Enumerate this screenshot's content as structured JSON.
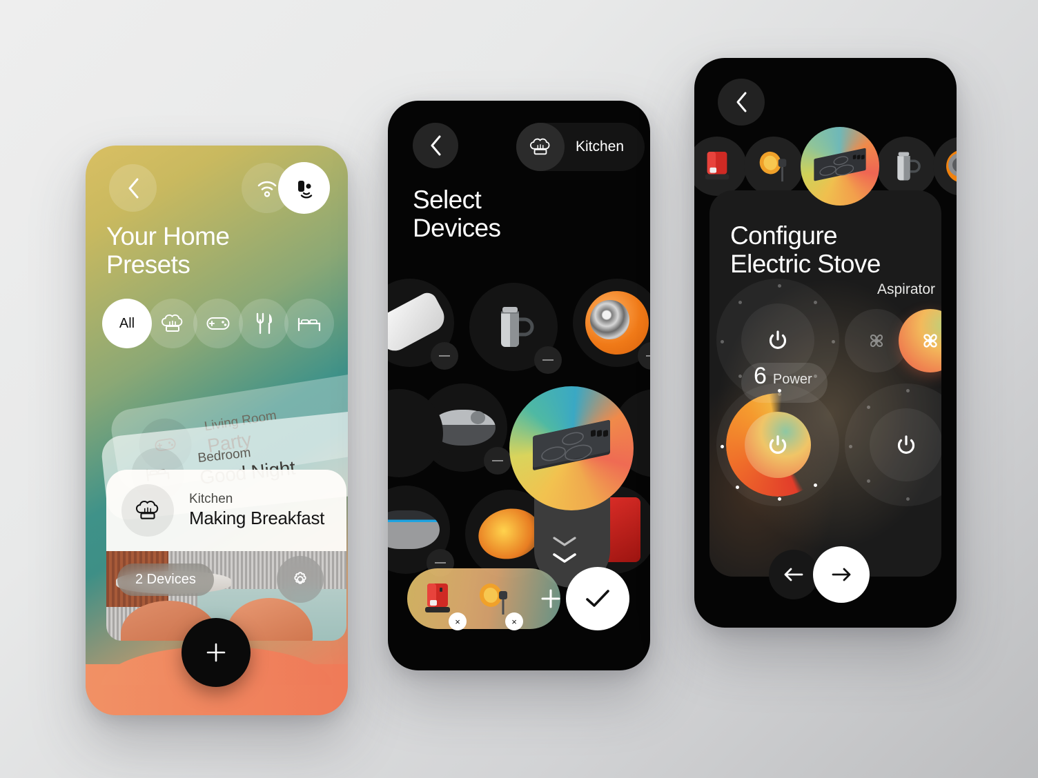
{
  "background": {
    "from": "#eeeeee",
    "to": "#bcbdbf"
  },
  "screen_presets": {
    "title_line1": "Your Home",
    "title_line2": "Presets",
    "back_icon": "chevron-left-icon",
    "wifi_icon": "wifi-icon",
    "cast_icon": "cast-device-icon",
    "categories": [
      {
        "label": "All",
        "icon": "all-label",
        "active": true
      },
      {
        "label": "Kitchen",
        "icon": "chef-hat-icon",
        "active": false
      },
      {
        "label": "Games",
        "icon": "gamepad-icon",
        "active": false
      },
      {
        "label": "Dining",
        "icon": "cutlery-icon",
        "active": false
      },
      {
        "label": "Bedroom",
        "icon": "bed-icon",
        "active": false
      }
    ],
    "cards": [
      {
        "room": "Living Room",
        "name": "Party",
        "icon": "gamepad-icon"
      },
      {
        "room": "Bedroom",
        "name": "Good Night",
        "icon": "bed-icon"
      },
      {
        "room": "Kitchen",
        "name": "Making Breakfast",
        "icon": "chef-hat-icon"
      }
    ],
    "devices_pill": "2 Devices",
    "settings_icon": "gear-icon",
    "add_button_icon": "plus-icon"
  },
  "screen_select": {
    "title_line1": "Select",
    "title_line2": "Devices",
    "back_icon": "chevron-left-icon",
    "room_chip": {
      "label": "Kitchen",
      "icon": "chef-hat-icon"
    },
    "devices": [
      {
        "name": "Air Conditioner",
        "icon": "air-conditioner-icon",
        "selected": false
      },
      {
        "name": "Electric Kettle",
        "icon": "kettle-icon",
        "selected": false
      },
      {
        "name": "Smart Speaker",
        "icon": "orange-speaker-icon",
        "selected": false
      },
      {
        "name": "Robot Vacuum",
        "icon": "robot-vacuum-icon",
        "selected": false
      },
      {
        "name": "Electric Stove",
        "icon": "electric-stove-icon",
        "selected": true
      },
      {
        "name": "Smart Assistant",
        "icon": "echo-dot-icon",
        "selected": false
      },
      {
        "name": "Studio Lamp",
        "icon": "studio-lamp-icon",
        "selected": false
      },
      {
        "name": "Coffee Machine",
        "icon": "coffee-machine-icon",
        "selected": false
      }
    ],
    "tray": [
      {
        "name": "Coffee Machine",
        "icon": "coffee-machine-icon",
        "remove_label": "×"
      },
      {
        "name": "Studio Lamp",
        "icon": "studio-lamp-icon",
        "remove_label": "×"
      }
    ],
    "add_icon": "plus-icon",
    "confirm_icon": "check-icon",
    "expand_icon": "chevron-down-icon"
  },
  "screen_configure": {
    "title_line1": "Configure",
    "title_line2": "Electric Stove",
    "back_icon": "chevron-left-icon",
    "carousel": [
      {
        "name": "Coffee Machine",
        "icon": "coffee-machine-icon",
        "active": false
      },
      {
        "name": "Studio Lamp",
        "icon": "studio-lamp-icon",
        "active": false
      },
      {
        "name": "Electric Stove",
        "icon": "electric-stove-icon",
        "active": true
      },
      {
        "name": "Electric Kettle",
        "icon": "kettle-icon",
        "active": false
      },
      {
        "name": "Smart Speaker",
        "icon": "orange-speaker-icon",
        "active": false
      }
    ],
    "aspirator": {
      "label": "Aspirator",
      "off_icon": "fan-icon",
      "on_icon": "fan-icon",
      "state": "on"
    },
    "power_badge": {
      "value": "6",
      "label": "Power"
    },
    "dials": [
      {
        "name": "burner-top-left",
        "icon": "power-icon",
        "state": "off"
      },
      {
        "name": "burner-bottom-left",
        "icon": "power-icon",
        "state": "on"
      },
      {
        "name": "burner-bottom-right",
        "icon": "power-icon",
        "state": "off"
      }
    ],
    "nav": {
      "prev_icon": "arrow-left-icon",
      "next_icon": "arrow-right-icon"
    },
    "accent": "#ef7f4e"
  }
}
